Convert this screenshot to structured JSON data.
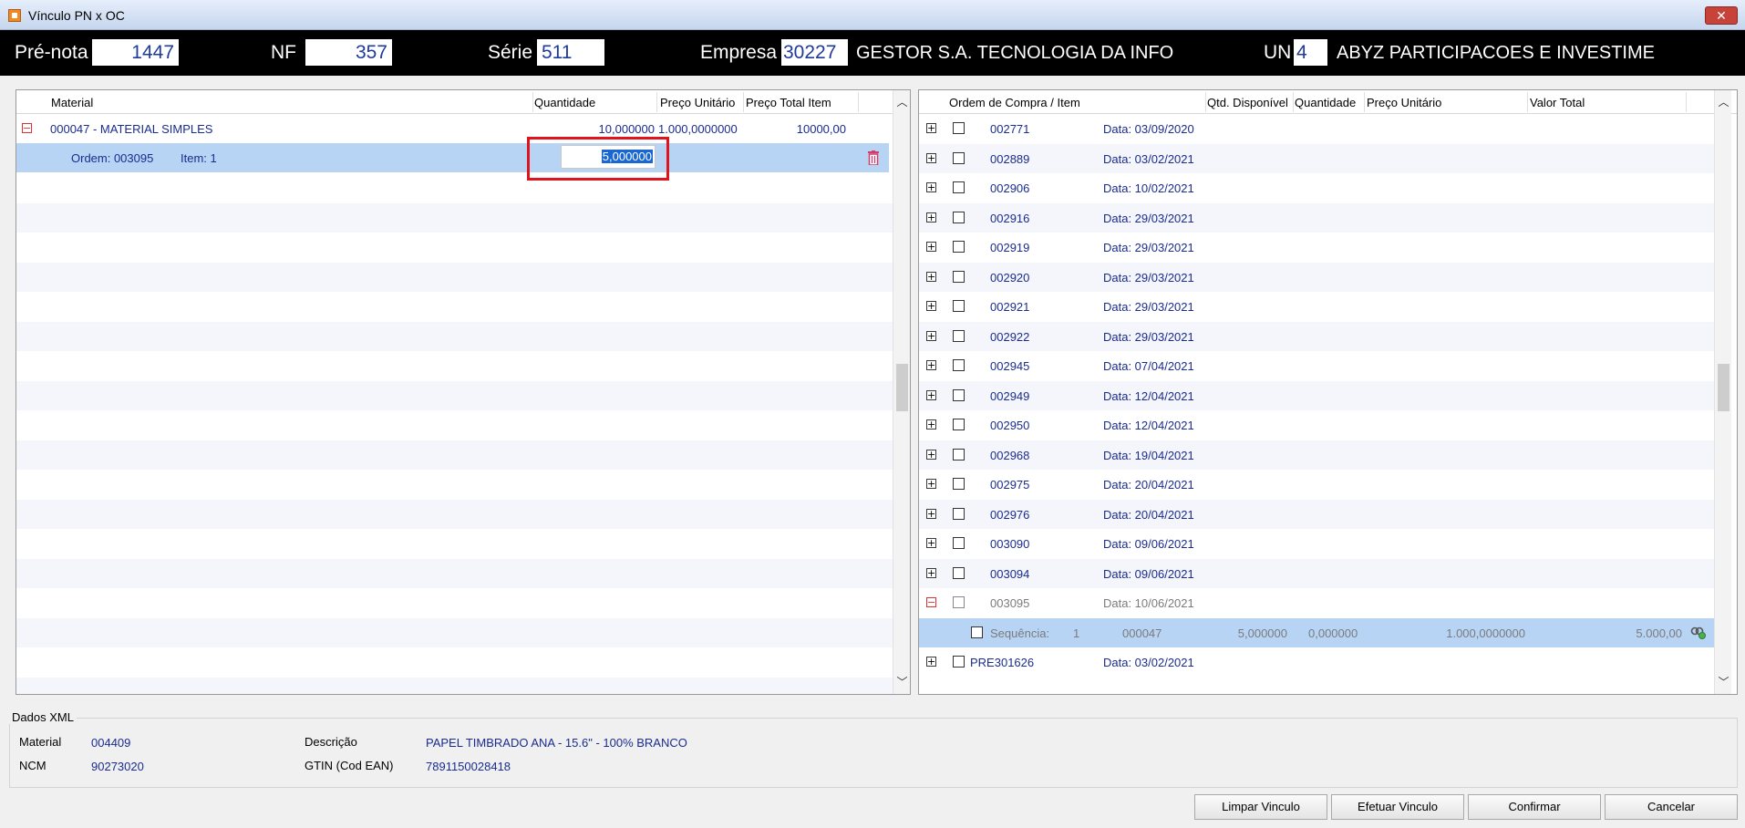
{
  "window": {
    "title": "Vínculo PN x OC",
    "close_glyph": "✕"
  },
  "header": {
    "prenota_label": "Pré-nota",
    "prenota_value": "1447",
    "nf_label": "NF",
    "nf_value": "357",
    "serie_label": "Série",
    "serie_value": "511",
    "empresa_label": "Empresa",
    "empresa_code": "30227",
    "empresa_name": "GESTOR S.A. TECNOLOGIA DA INFO",
    "un_label": "UN",
    "un_code": "4",
    "un_name": "ABYZ PARTICIPACOES E INVESTIME"
  },
  "left_grid": {
    "headers": {
      "material": "Material",
      "quantidade": "Quantidade",
      "preco_unitario": "Preço Unitário",
      "preco_total": "Preço Total Item"
    },
    "material_row": {
      "expander": "−",
      "material": "000047 - MATERIAL SIMPLES",
      "quantidade": "10,000000",
      "preco_unitario": "1.000,0000000",
      "preco_total": "10000,00"
    },
    "order_row": {
      "ordem": "Ordem: 003095",
      "item": "Item: 1",
      "quantidade": "5,000000",
      "trash_icon": "trash-icon"
    }
  },
  "right_grid": {
    "headers": {
      "ordem_item": "Ordem de Compra / Item",
      "qtd_disponivel": "Qtd. Disponível",
      "quantidade": "Quantidade",
      "preco_unitario": "Preço Unitário",
      "valor_total": "Valor Total"
    },
    "orders": [
      {
        "number": "002771",
        "date": "Data: 03/09/2020",
        "expander": "+"
      },
      {
        "number": "002889",
        "date": "Data: 03/02/2021",
        "expander": "+"
      },
      {
        "number": "002906",
        "date": "Data: 10/02/2021",
        "expander": "+"
      },
      {
        "number": "002916",
        "date": "Data: 29/03/2021",
        "expander": "+"
      },
      {
        "number": "002919",
        "date": "Data: 29/03/2021",
        "expander": "+"
      },
      {
        "number": "002920",
        "date": "Data: 29/03/2021",
        "expander": "+"
      },
      {
        "number": "002921",
        "date": "Data: 29/03/2021",
        "expander": "+"
      },
      {
        "number": "002922",
        "date": "Data: 29/03/2021",
        "expander": "+"
      },
      {
        "number": "002945",
        "date": "Data: 07/04/2021",
        "expander": "+"
      },
      {
        "number": "002949",
        "date": "Data: 12/04/2021",
        "expander": "+"
      },
      {
        "number": "002950",
        "date": "Data: 12/04/2021",
        "expander": "+"
      },
      {
        "number": "002968",
        "date": "Data: 19/04/2021",
        "expander": "+"
      },
      {
        "number": "002975",
        "date": "Data: 20/04/2021",
        "expander": "+"
      },
      {
        "number": "002976",
        "date": "Data: 20/04/2021",
        "expander": "+"
      },
      {
        "number": "003090",
        "date": "Data: 09/06/2021",
        "expander": "+"
      },
      {
        "number": "003094",
        "date": "Data: 09/06/2021",
        "expander": "+"
      },
      {
        "number": "003095",
        "date": "Data: 10/06/2021",
        "expander": "−",
        "expanded": true
      }
    ],
    "sequence_row": {
      "label": "Sequência:",
      "seq": "1",
      "material": "000047",
      "qtd_disponivel": "5,000000",
      "quantidade": "0,000000",
      "preco_unitario": "1.000,0000000",
      "valor_total": "5.000,00",
      "icon": "link-icon"
    },
    "last_order": {
      "number": "PRE301626",
      "date": "Data: 03/02/2021",
      "expander": "+"
    }
  },
  "xml": {
    "legend": "Dados XML",
    "material_label": "Material",
    "material_value": "004409",
    "descricao_label": "Descrição",
    "descricao_value": "PAPEL TIMBRADO ANA - 15.6\" - 100% BRANCO",
    "ncm_label": "NCM",
    "ncm_value": "90273020",
    "gtin_label": "GTIN (Cod EAN)",
    "gtin_value": "7891150028418"
  },
  "buttons": {
    "limpar": "Limpar Vinculo",
    "efetuar": "Efetuar Vinculo",
    "confirmar": "Confirmar",
    "cancelar": "Cancelar"
  },
  "colors": {
    "link_text": "#1a2c8e",
    "selection": "#b7d4f5",
    "highlight_border": "#e0141c",
    "header_bg": "#000000"
  }
}
